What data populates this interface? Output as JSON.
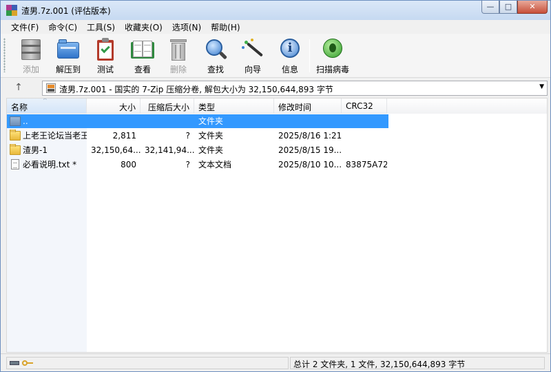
{
  "window": {
    "title": "渣男.7z.001 (评估版本)",
    "controls": {
      "minimize": "—",
      "maximize": "□",
      "close": "✕"
    }
  },
  "menu": [
    "文件(F)",
    "命令(C)",
    "工具(S)",
    "收藏夹(O)",
    "选项(N)",
    "帮助(H)"
  ],
  "toolbar": {
    "add": "添加",
    "extract": "解压到",
    "test": "测试",
    "view": "查看",
    "delete": "删除",
    "find": "查找",
    "wizard": "向导",
    "info": "信息",
    "scan": "扫描病毒"
  },
  "address": {
    "up": "↑",
    "text": "渣男.7z.001 - 国实的 7-Zip 压缩分卷, 解包大小为 32,150,644,893 字节",
    "dropdown": "▼"
  },
  "columns": {
    "name": "名称",
    "size": "大小",
    "packed": "压缩后大小",
    "type": "类型",
    "modified": "修改时间",
    "crc": "CRC32"
  },
  "files": [
    {
      "name": "..",
      "size": "",
      "packed": "",
      "type": "文件夹",
      "modified": "",
      "crc": "",
      "icon": "parent-folder-icon"
    },
    {
      "name": "上老王论坛当老王",
      "size": "2,811",
      "packed": "?",
      "type": "文件夹",
      "modified": "2025/8/16 1:21",
      "crc": "",
      "icon": "folder-icon"
    },
    {
      "name": "渣男-1",
      "size": "32,150,64...",
      "packed": "32,141,94...",
      "type": "文件夹",
      "modified": "2025/8/15 19...",
      "crc": "",
      "icon": "folder-icon"
    },
    {
      "name": "必看说明.txt *",
      "size": "800",
      "packed": "?",
      "type": "文本文档",
      "modified": "2025/8/10 10...",
      "crc": "83875A72",
      "icon": "text-file-icon"
    }
  ],
  "status": {
    "summary": "总计 2 文件夹, 1 文件, 32,150,644,893 字节"
  }
}
